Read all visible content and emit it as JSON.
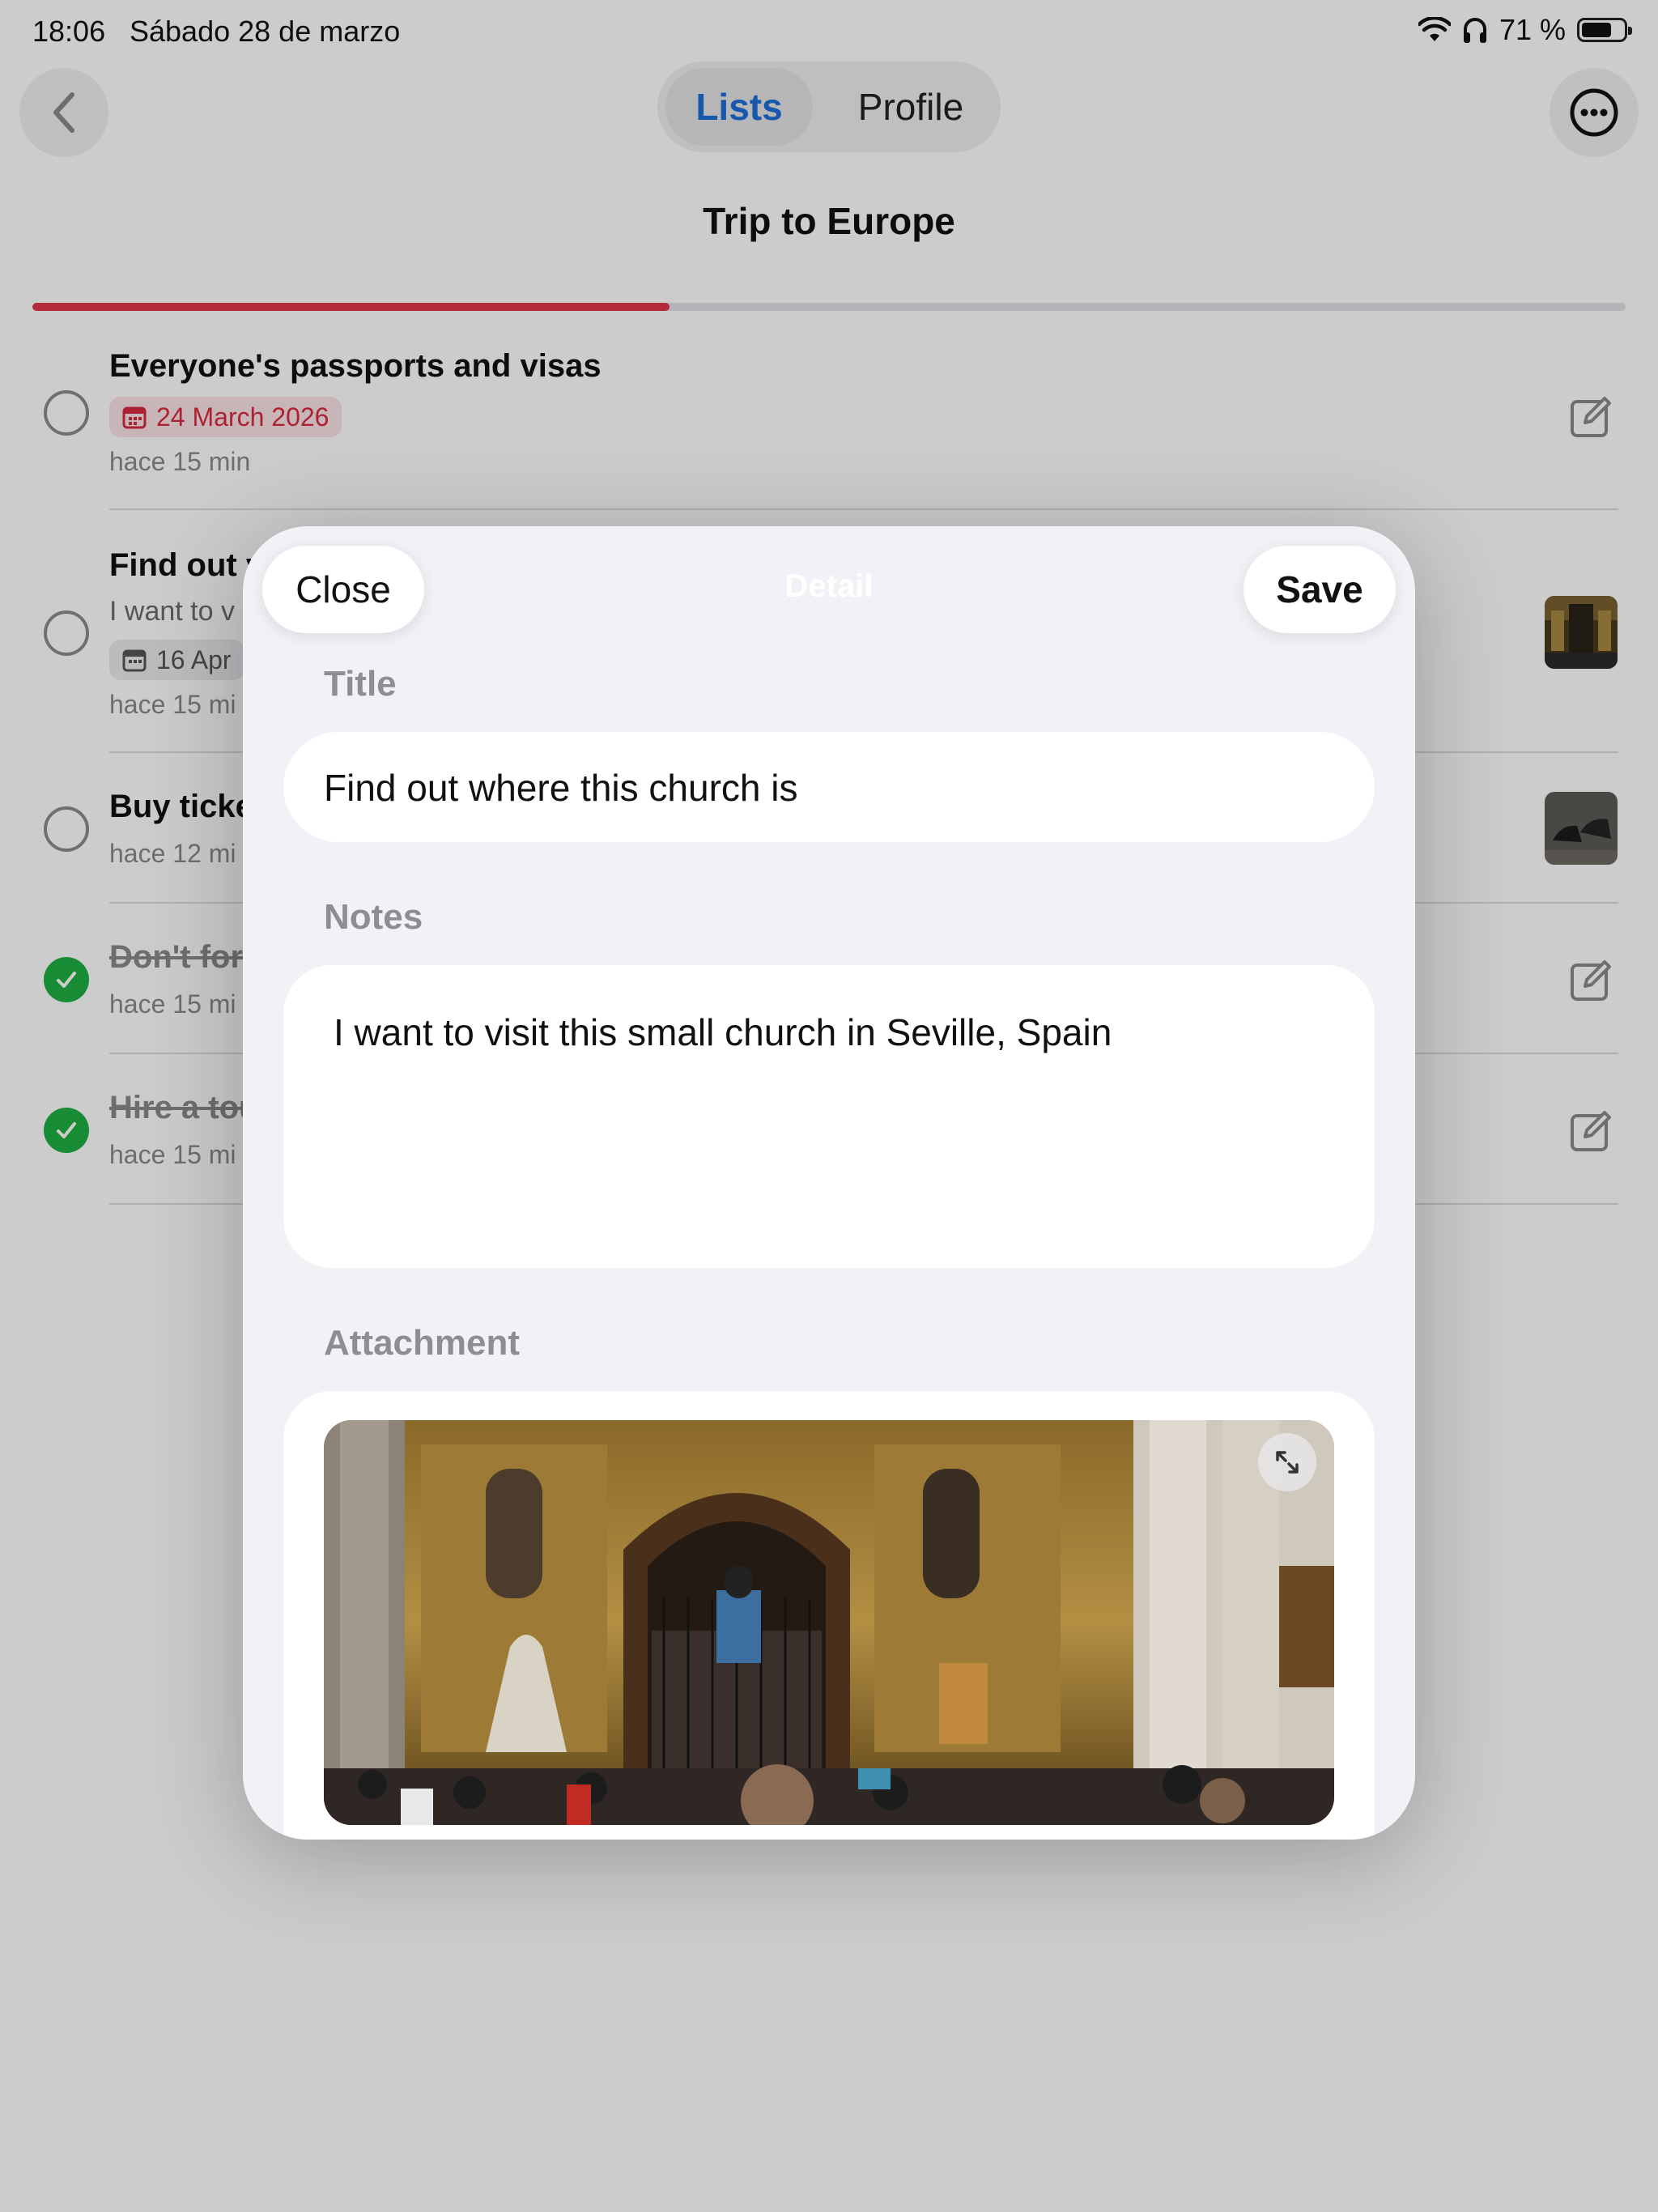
{
  "status_bar": {
    "time": "18:06",
    "date": "Sábado 28 de marzo",
    "battery_text": "71 %",
    "battery_level": 0.71,
    "icons": [
      "wifi-icon",
      "headphones-icon",
      "battery-icon"
    ]
  },
  "nav": {
    "back_icon": "chevron-left-icon",
    "tabs": [
      {
        "label": "Lists",
        "selected": true
      },
      {
        "label": "Profile",
        "selected": false
      }
    ],
    "more_icon": "ellipsis-circle-icon"
  },
  "list": {
    "title": "Trip to Europe",
    "progress": 0.4,
    "accent_color": "#e0364a",
    "items": [
      {
        "title": "Everyone's passports and visas",
        "date": "24 March 2026",
        "date_style": "overdue",
        "time": "hace 15 min",
        "done": false,
        "trailing": "edit-icon"
      },
      {
        "title": "Find out v",
        "note": "I want to v",
        "date": "16 Apr",
        "date_style": "normal",
        "time": "hace 15 mi",
        "done": false,
        "trailing": "thumbnail"
      },
      {
        "title": "Buy ticke",
        "time": "hace 12 mi",
        "done": false,
        "trailing": "thumbnail"
      },
      {
        "title": "Don't for",
        "time": "hace 15 mi",
        "done": true,
        "trailing": "edit-icon"
      },
      {
        "title": "Hire a tou",
        "time": "hace 15 mi",
        "done": true,
        "trailing": "edit-icon"
      }
    ]
  },
  "sheet": {
    "close_label": "Close",
    "header": "Detail",
    "save_label": "Save",
    "title_label": "Title",
    "title_value": "Find out where this church is",
    "notes_label": "Notes",
    "notes_value": "I want to visit this small church in Seville, Spain",
    "attachment_label": "Attachment",
    "expand_icon": "expand-arrows-icon"
  }
}
